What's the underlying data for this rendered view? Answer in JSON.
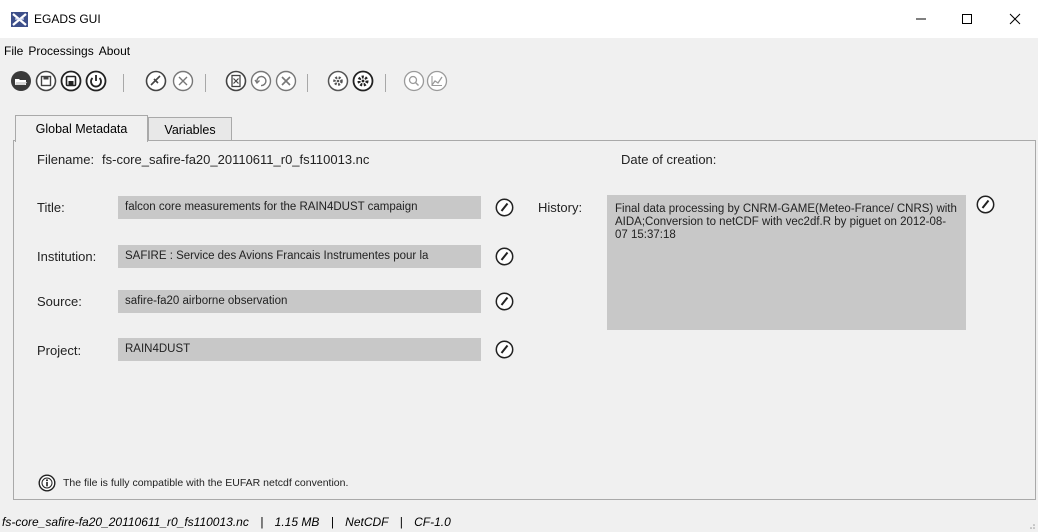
{
  "window": {
    "title": "EGADS GUI",
    "controls": {
      "minimize": "—",
      "maximize": "☐",
      "close": "✕"
    }
  },
  "menu": [
    "File",
    "Processings",
    "About"
  ],
  "toolbar": {
    "buttons": [
      "open-file-icon",
      "save-icon",
      "save-as-icon",
      "power-icon",
      "plot-icon",
      "clear-plot-icon",
      "algorithm-doc-icon",
      "undo-icon",
      "delete-icon",
      "settings-icon",
      "advanced-settings-icon",
      "search-icon",
      "chart-icon"
    ]
  },
  "tabs": [
    {
      "label": "Global Metadata",
      "active": true
    },
    {
      "label": "Variables",
      "active": false
    }
  ],
  "metadata": {
    "filename_label": "Filename:",
    "filename_value": "fs-core_safire-fa20_20110611_r0_fs110013.nc",
    "date_label": "Date of creation:",
    "title_label": "Title:",
    "title_value": "falcon core measurements for the RAIN4DUST campaign",
    "institution_label": "Institution:",
    "institution_value": "SAFIRE : Service des Avions Francais Instrumentes pour la",
    "source_label": "Source:",
    "source_value": "safire-fa20 airborne observation",
    "project_label": "Project:",
    "project_value": "RAIN4DUST",
    "history_label": "History:",
    "history_value": "Final data processing by CNRM-GAME(Meteo-France/ CNRS) with AIDA;Conversion to netCDF with vec2df.R by piguet on 2012-08-07 15:37:18",
    "compat_message": "The file is fully compatible with the EUFAR netcdf convention."
  },
  "status": {
    "file": "fs-core_safire-fa20_20110611_r0_fs110013.nc",
    "size": "1.15 MB",
    "format": "NetCDF",
    "convention": "CF-1.0",
    "separator": "|"
  },
  "colors": {
    "background": "#f0f0f0",
    "field_bg": "#c8c8c8",
    "icon_stroke": "#333333",
    "disabled_icon": "#9a9a9a"
  }
}
